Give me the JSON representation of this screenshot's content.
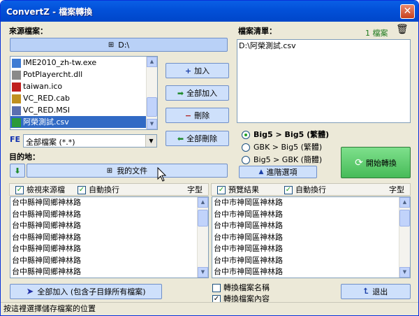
{
  "window": {
    "title": "ConvertZ - 檔案轉換",
    "close_glyph": "✕"
  },
  "source": {
    "label": "來源檔案：",
    "path": "D:\\",
    "files": [
      {
        "name": "IME2010_zh-tw.exe",
        "icon": "exe-icon"
      },
      {
        "name": "PotPlayercht.dll",
        "icon": "dll-icon"
      },
      {
        "name": "taiwan.ico",
        "icon": "flag-icon"
      },
      {
        "name": "VC_RED.cab",
        "icon": "cab-icon"
      },
      {
        "name": "VC_RED.MSI",
        "icon": "msi-icon"
      },
      {
        "name": "阿榮測試.csv",
        "icon": "csv-icon",
        "selected": true
      }
    ],
    "filter_badge": "FE",
    "filter_value": "全部檔案 (*.*)"
  },
  "actions": {
    "add": "加入",
    "add_all": "全部加入",
    "remove": "刪除",
    "remove_all": "全部刪除"
  },
  "filelist": {
    "label": "檔案清單：",
    "count": "1 檔案",
    "items": [
      "D:\\阿榮測試.csv"
    ]
  },
  "conversion": {
    "options": [
      {
        "label": "Big5 > Big5 (繁體)",
        "checked": true,
        "bold": true
      },
      {
        "label": "GBK > Big5 (繁體)",
        "checked": false
      },
      {
        "label": "Big5 > GBK (簡體)",
        "checked": false
      }
    ],
    "advanced": "進階選項",
    "start": "開始轉換"
  },
  "destination": {
    "label": "目的地：",
    "path": "我的文件"
  },
  "left_panel": {
    "view_source": "檢視來源檔",
    "auto_wrap": "自動換行",
    "font": "字型",
    "lines": [
      "台中縣神岡鄉神林路",
      "台中縣神岡鄉神林路",
      "台中縣神岡鄉神林路",
      "台中縣神岡鄉神林路",
      "台中縣神岡鄉神林路",
      "台中縣神岡鄉神林路",
      "台中縣神岡鄉神林路"
    ]
  },
  "right_panel": {
    "preview": "預覽結果",
    "auto_wrap": "自動換行",
    "font": "字型",
    "lines": [
      "台中市神岡區神林路",
      "台中市神岡區神林路",
      "台中市神岡區神林路",
      "台中市神岡區神林路",
      "台中市神岡區神林路",
      "台中市神岡區神林路",
      "台中市神岡區神林路"
    ]
  },
  "footer": {
    "add_all_sub": "全部加入 (包含子目錄所有檔案)",
    "convert_name": "轉換檔案名稱",
    "convert_content": "轉換檔案內容",
    "exit": "退出"
  },
  "status": "按這裡選擇儲存檔案的位置",
  "colors": {
    "title_bar": "#0250d8",
    "button_face": "#cee0fb",
    "start_button": "#5fd073",
    "selection": "#316ac5"
  }
}
